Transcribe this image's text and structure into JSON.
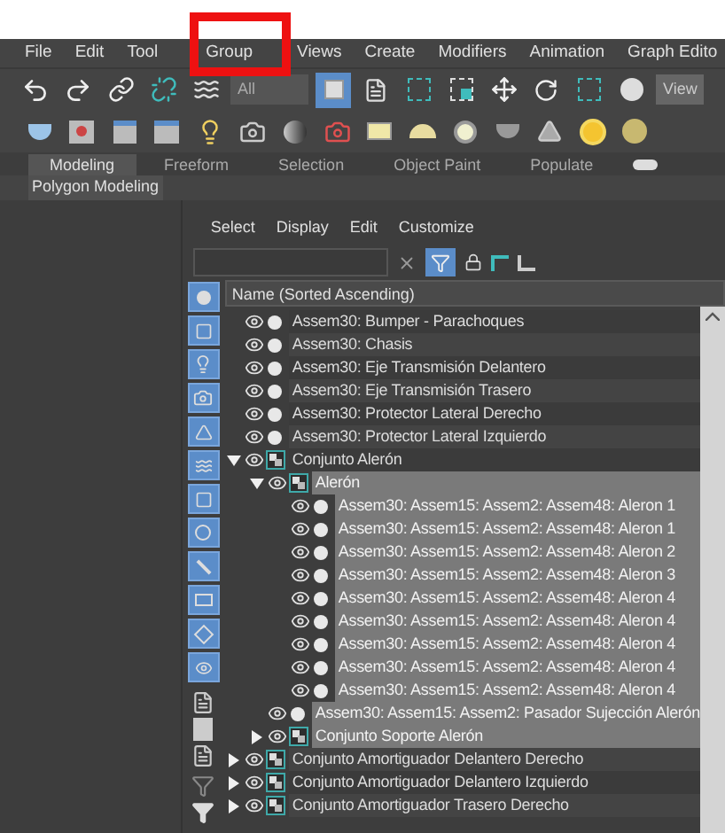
{
  "menu_bar": [
    "File",
    "Edit",
    "Tool",
    "Group",
    "Views",
    "Create",
    "Modifiers",
    "Animation",
    "Graph Edito"
  ],
  "toolbar": {
    "selection_filter": "All",
    "select_object_on": true,
    "reference_coord": "View"
  },
  "ribbon": {
    "tabs": [
      {
        "label": "Modeling",
        "selected": true
      },
      {
        "label": "Freeform",
        "selected": false
      },
      {
        "label": "Selection",
        "selected": false
      },
      {
        "label": "Object Paint",
        "selected": false
      },
      {
        "label": "Populate",
        "selected": false
      }
    ],
    "panel_label": "Polygon Modeling"
  },
  "scene_explorer": {
    "menu": [
      "Select",
      "Display",
      "Edit",
      "Customize"
    ],
    "filter_on": true,
    "column_header": "Name (Sorted Ascending)",
    "filter_buttons": [
      {
        "on": true
      },
      {
        "on": true
      },
      {
        "on": true
      },
      {
        "on": true
      },
      {
        "on": true
      },
      {
        "on": true
      },
      {
        "on": true
      },
      {
        "on": true
      },
      {
        "on": true
      },
      {
        "on": true
      },
      {
        "on": true
      },
      {
        "on": true
      }
    ],
    "tree": [
      {
        "name": "Assem30: Bumper - Parachoques",
        "kind": "object",
        "selected": false
      },
      {
        "name": "Assem30: Chasis",
        "kind": "object",
        "selected": false
      },
      {
        "name": "Assem30: Eje Transmisión Delantero",
        "kind": "object",
        "selected": false
      },
      {
        "name": "Assem30: Eje Transmisión Trasero",
        "kind": "object",
        "selected": false
      },
      {
        "name": "Assem30: Protector Lateral Derecho",
        "kind": "object",
        "selected": false
      },
      {
        "name": "Assem30: Protector Lateral Izquierdo",
        "kind": "object",
        "selected": false
      },
      {
        "name": "Conjunto Alerón",
        "kind": "group",
        "selected": false,
        "expanded": true,
        "children": [
          {
            "name": "Alerón",
            "kind": "group",
            "selected": true,
            "expanded": true,
            "children": [
              {
                "name": "Assem30: Assem15: Assem2: Assem48: Aleron 1",
                "kind": "object",
                "selected": true
              },
              {
                "name": "Assem30: Assem15: Assem2: Assem48: Aleron 1",
                "kind": "object",
                "selected": true
              },
              {
                "name": "Assem30: Assem15: Assem2: Assem48: Aleron 2",
                "kind": "object",
                "selected": true
              },
              {
                "name": "Assem30: Assem15: Assem2: Assem48: Aleron 3",
                "kind": "object",
                "selected": true
              },
              {
                "name": "Assem30: Assem15: Assem2: Assem48: Aleron 4",
                "kind": "object",
                "selected": true
              },
              {
                "name": "Assem30: Assem15: Assem2: Assem48: Aleron 4",
                "kind": "object",
                "selected": true
              },
              {
                "name": "Assem30: Assem15: Assem2: Assem48: Aleron 4",
                "kind": "object",
                "selected": true
              },
              {
                "name": "Assem30: Assem15: Assem2: Assem48: Aleron 4",
                "kind": "object",
                "selected": true
              },
              {
                "name": "Assem30: Assem15: Assem2: Assem48: Aleron 4",
                "kind": "object",
                "selected": true
              }
            ]
          },
          {
            "name": "Assem30: Assem15: Assem2: Pasador Sujección Alerón",
            "kind": "object",
            "selected": true
          },
          {
            "name": "Conjunto Soporte Alerón",
            "kind": "group",
            "selected": true,
            "expanded": false
          }
        ]
      },
      {
        "name": "Conjunto Amortiguador Delantero Derecho",
        "kind": "group",
        "selected": false,
        "expanded": false
      },
      {
        "name": "Conjunto Amortiguador Delantero Izquierdo",
        "kind": "group",
        "selected": false,
        "expanded": false
      },
      {
        "name": "Conjunto Amortiguador Trasero Derecho",
        "kind": "group",
        "selected": false,
        "expanded": false
      }
    ]
  }
}
